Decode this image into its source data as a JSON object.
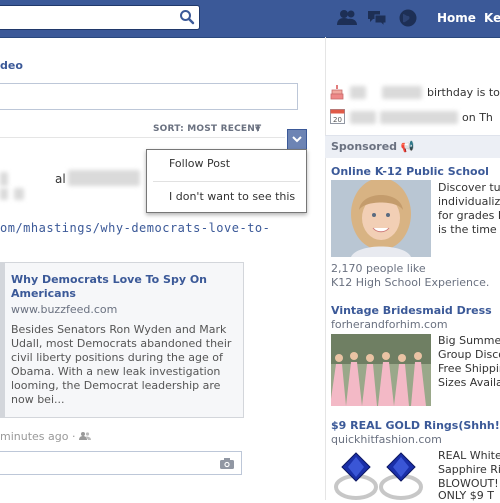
{
  "topbar": {
    "search": {
      "value": "",
      "placeholder": ""
    },
    "nav": {
      "home": "Home",
      "profile": "Ke"
    }
  },
  "feed": {
    "tab_label": "deo",
    "sort_label": "SORT: MOST RECENT",
    "options_menu": {
      "follow": "Follow Post",
      "hide": "I don't want to see this"
    },
    "post": {
      "author_text": "al",
      "link_text": "om/mhastings/why-democrats-love-to-",
      "share": {
        "title": "Why Democrats Love To Spy On Americans",
        "domain": "www.buzzfeed.com",
        "description": "Besides Senators Ron Wyden and Mark Udall, most Democrats abandoned their civil liberty positions during the age of Obama. With a new leak investigation looming, the Democrat leadership are now bei..."
      },
      "time": "minutes ago ·"
    }
  },
  "right": {
    "birthday_text": "birthday is to",
    "event_text": "on Th",
    "sponsored_label": "Sponsored",
    "ads": [
      {
        "title": "Online K-12 Public School",
        "body": [
          "Discover tui",
          "individualiz",
          "for grades K",
          "is the time t"
        ],
        "likes": [
          "2,170 people like",
          "K12 High School Experience."
        ]
      },
      {
        "title": "Vintage Bridesmaid Dress",
        "domain": "forherandforhim.com",
        "body": [
          "Big Summer",
          "Group Disco",
          "Free Shippin",
          "Sizes Availa"
        ]
      },
      {
        "title": "$9 REAL GOLD Rings(Shhh!)",
        "domain": "quickhitfashion.com",
        "body": [
          "REAL White",
          "Sapphire Rin",
          "BLOWOUT! T",
          "ONLY $9 T"
        ]
      }
    ]
  },
  "colors": {
    "brand": "#3b5998",
    "link": "#3b5998",
    "muted": "#6a7180"
  }
}
